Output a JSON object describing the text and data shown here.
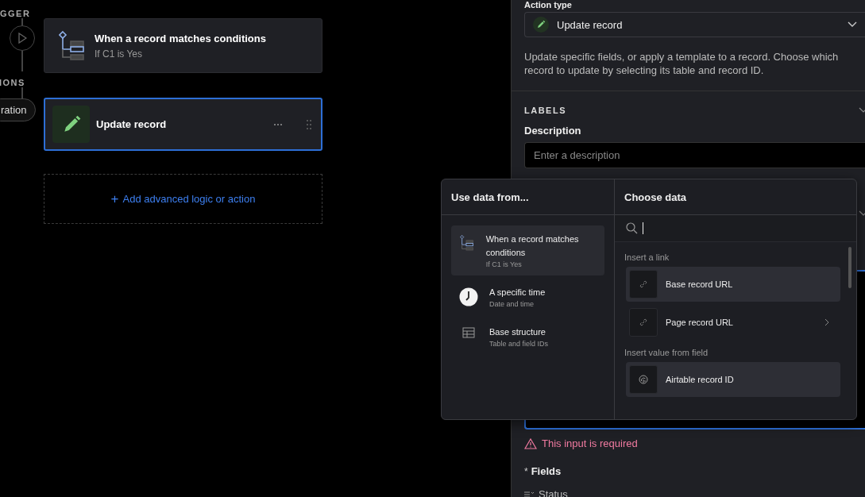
{
  "flow": {
    "trigger_label": "GGER",
    "actions_label": "IONS",
    "side_pill": "ration",
    "trigger_card": {
      "title": "When a record matches conditions",
      "subtitle": "If C1 is Yes"
    },
    "action_card": {
      "title": "Update record",
      "selected": true
    },
    "add_button": {
      "icon": "+",
      "label": "Add advanced logic or action"
    }
  },
  "panel": {
    "action_type_label": "Action type",
    "action_type_value": "Update record",
    "help_text": "Update specific fields, or apply a template to a record. Choose which record to update by selecting its table and record ID.",
    "labels_heading": "LABELS",
    "description_label": "Description",
    "description_placeholder": "Enter a description",
    "error": "This input is required",
    "required_mark": "*",
    "fields_label": "Fields",
    "field_name": "Status"
  },
  "popup": {
    "sources_title": "Use data from...",
    "choose_title": "Choose data",
    "sources": [
      {
        "kind": "trigger",
        "title": "When a record matches conditions",
        "subtitle": "If C1 is Yes",
        "selected": true
      },
      {
        "kind": "time",
        "title": "A specific time",
        "subtitle": "Date and time",
        "selected": false
      },
      {
        "kind": "table",
        "title": "Base structure",
        "subtitle": "Table and field IDs",
        "selected": false
      }
    ],
    "groups": [
      {
        "heading": "Insert a link",
        "items": [
          {
            "kind": "link",
            "label": "Base record URL",
            "selected": true,
            "expandable": false
          },
          {
            "kind": "link",
            "label": "Page record URL",
            "selected": false,
            "expandable": true
          }
        ]
      },
      {
        "heading": "Insert value from field",
        "items": [
          {
            "kind": "id",
            "label": "Airtable record ID",
            "selected": true,
            "expandable": false
          }
        ]
      }
    ]
  }
}
